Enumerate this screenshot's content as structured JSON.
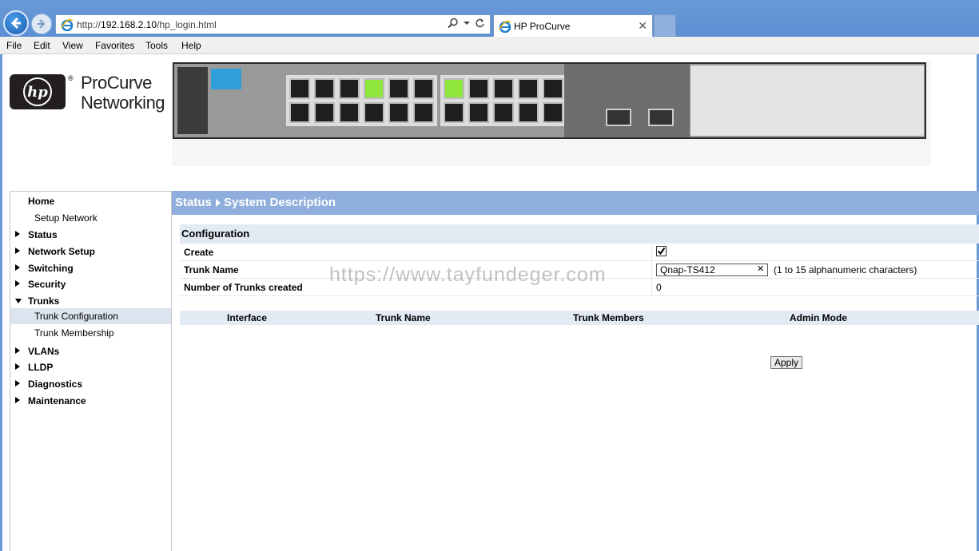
{
  "browser": {
    "url_prefix": "http://",
    "url_domain": "192.168.2.10",
    "url_path": "/hp_login.html",
    "tab_title": "HP ProCurve",
    "menu": [
      "File",
      "Edit",
      "View",
      "Favorites",
      "Tools",
      "Help"
    ]
  },
  "header": {
    "logo_text": "hp",
    "brand_line1": "ProCurve",
    "brand_line2": "Networking",
    "registered": "®"
  },
  "sidebar": {
    "items": [
      {
        "label": "Home",
        "type": "top",
        "arrow": "none"
      },
      {
        "label": "Setup Network",
        "type": "sub"
      },
      {
        "label": "Status",
        "type": "top",
        "arrow": "right"
      },
      {
        "label": "Network Setup",
        "type": "top",
        "arrow": "right"
      },
      {
        "label": "Switching",
        "type": "top",
        "arrow": "right"
      },
      {
        "label": "Security",
        "type": "top",
        "arrow": "right"
      },
      {
        "label": "Trunks",
        "type": "top",
        "arrow": "down"
      },
      {
        "label": "Trunk Configuration",
        "type": "sub",
        "selected": true
      },
      {
        "label": "Trunk Membership",
        "type": "sub"
      },
      {
        "label": "VLANs",
        "type": "top",
        "arrow": "right"
      },
      {
        "label": "LLDP",
        "type": "top",
        "arrow": "right"
      },
      {
        "label": "Diagnostics",
        "type": "top",
        "arrow": "right"
      },
      {
        "label": "Maintenance",
        "type": "top",
        "arrow": "right"
      }
    ]
  },
  "main": {
    "breadcrumb": [
      "Status",
      "System Description"
    ],
    "section_title": "Configuration",
    "fields": {
      "create_label": "Create",
      "create_checked": true,
      "trunk_name_label": "Trunk Name",
      "trunk_name_value": "Qnap-TS412",
      "trunk_name_hint": "(1 to 15 alphanumeric characters)",
      "num_trunks_label": "Number of Trunks created",
      "num_trunks_value": "0"
    },
    "table_headers": [
      "Interface",
      "Trunk Name",
      "Trunk Members",
      "Admin Mode"
    ],
    "apply_label": "Apply"
  },
  "watermark": "https://www.tayfundeger.com",
  "colors": {
    "title_bar": "#90aedb",
    "section_bg": "#e2eaf4",
    "selected_item": "#dbe4ef",
    "link_led": "#8ee63a"
  }
}
